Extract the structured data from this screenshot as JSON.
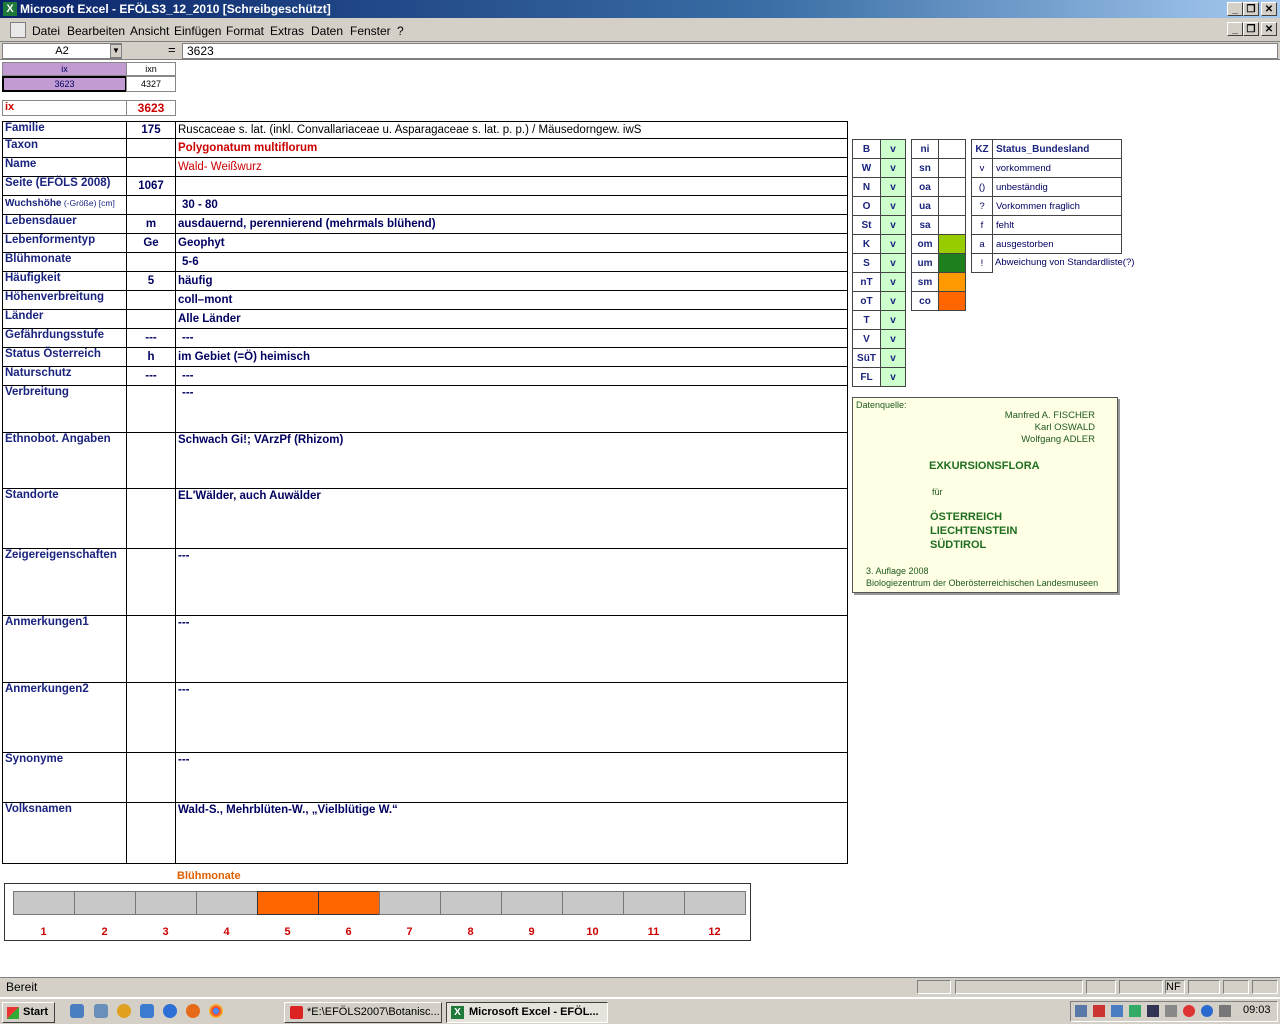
{
  "window": {
    "title": "Microsoft Excel - EFÖLS3_12_2010  [Schreibgeschützt]",
    "controls": [
      "_",
      "❐",
      "✕"
    ]
  },
  "menu": [
    "Datei",
    "Bearbeiten",
    "Ansicht",
    "Einfügen",
    "Format",
    "Extras",
    "Daten",
    "Fenster",
    "?"
  ],
  "formula": {
    "namebox": "A2",
    "eq": "=",
    "value": "3623"
  },
  "top": {
    "ix_header": "ix",
    "ixn_header": "ixn",
    "ix_value": "3623",
    "ixn_value": "4327",
    "ix_label": "ix",
    "ix_big": "3623"
  },
  "rows": [
    {
      "label": "Familie",
      "code": "175",
      "value": "Ruscaceae s. lat. (inkl. Convallariaceae u. Asparagaceae s. lat. p. p.)  /  Mäusedorngew. iwS"
    },
    {
      "label": "Taxon",
      "code": "",
      "value": "Polygonatum multiflorum"
    },
    {
      "label": "Name",
      "code": "",
      "value": "Wald- Weißwurz"
    },
    {
      "label": "Seite (EFÖLS 2008)",
      "code": "1067",
      "value": ""
    },
    {
      "label": "Wuchshöhe",
      "label_small": " (-Größe) [cm]",
      "code": "",
      "value": "30 - 80"
    },
    {
      "label": "Lebensdauer",
      "code": "m",
      "value": "ausdauernd, perennierend (mehrmals blühend)"
    },
    {
      "label": "Lebenformentyp",
      "code": "Ge",
      "value": "Geophyt"
    },
    {
      "label": "Blühmonate",
      "code": "",
      "value": "5-6"
    },
    {
      "label": "Häufigkeit",
      "code": "5",
      "value": "häufig"
    },
    {
      "label": "Höhenverbreitung",
      "code": "",
      "value": "coll–mont"
    },
    {
      "label": "Länder",
      "code": "",
      "value": "Alle Länder"
    },
    {
      "label": "Gefährdungsstufe",
      "code": "---",
      "value": "---"
    },
    {
      "label": "Status Österreich",
      "code": "h",
      "value": "im Gebiet (=Ö) heimisch"
    },
    {
      "label": "Naturschutz",
      "code": "---",
      "value": "---"
    },
    {
      "label": "Verbreitung",
      "code": "",
      "value": "---"
    },
    {
      "label": "Ethnobot. Angaben",
      "code": "",
      "value": "Schwach Gi!; VArzPf (Rhizom)"
    },
    {
      "label": "Standorte",
      "code": "",
      "value": "EL'Wälder, auch Auwälder"
    },
    {
      "label": "Zeigereigenschaften",
      "code": "",
      "value": "---"
    },
    {
      "label": "Anmerkungen1",
      "code": "",
      "value": "---"
    },
    {
      "label": "Anmerkungen2",
      "code": "",
      "value": "---"
    },
    {
      "label": "Synonyme",
      "code": "",
      "value": "---"
    },
    {
      "label": "Volksnamen",
      "code": "",
      "value": "Wald-S., Mehrblüten-W., „Vielblütige W.“"
    }
  ],
  "states": [
    {
      "code": "B",
      "v": "v"
    },
    {
      "code": "W",
      "v": "v"
    },
    {
      "code": "N",
      "v": "v"
    },
    {
      "code": "O",
      "v": "v"
    },
    {
      "code": "St",
      "v": "v"
    },
    {
      "code": "K",
      "v": "v"
    },
    {
      "code": "S",
      "v": "v"
    },
    {
      "code": "nT",
      "v": "v"
    },
    {
      "code": "oT",
      "v": "v"
    },
    {
      "code": "T",
      "v": "v"
    },
    {
      "code": "V",
      "v": "v"
    },
    {
      "code": "SüT",
      "v": "v"
    },
    {
      "code": "FL",
      "v": "v"
    }
  ],
  "zones": [
    {
      "code": "ni",
      "color": ""
    },
    {
      "code": "sn",
      "color": ""
    },
    {
      "code": "oa",
      "color": ""
    },
    {
      "code": "ua",
      "color": ""
    },
    {
      "code": "sa",
      "color": ""
    },
    {
      "code": "om",
      "color": "#99cc00"
    },
    {
      "code": "um",
      "color": "#1e7f1e"
    },
    {
      "code": "sm",
      "color": "#ff9900"
    },
    {
      "code": "co",
      "color": "#ff6600"
    }
  ],
  "status_legend": {
    "header_kz": "KZ",
    "header_status": "Status_Bundesland",
    "items": [
      {
        "kz": "v",
        "text": "vorkommend"
      },
      {
        "kz": "()",
        "text": "unbeständig"
      },
      {
        "kz": "?",
        "text": "Vorkommen fraglich"
      },
      {
        "kz": "f",
        "text": "fehlt"
      },
      {
        "kz": "a",
        "text": "ausgestorben"
      },
      {
        "kz": "!",
        "text": "Abweichung von Standardliste(?)"
      }
    ]
  },
  "source": {
    "label": "Datenquelle:",
    "authors": [
      "Manfred A. FISCHER",
      "Karl OSWALD",
      "Wolfgang ADLER"
    ],
    "title": "EXKURSIONSFLORA",
    "fuer": "für",
    "countries": [
      "ÖSTERREICH",
      "LIECHTENSTEIN",
      "SÜDTIROL"
    ],
    "edition": "3. Auflage 2008",
    "publisher": "Biologiezentrum der Oberösterreichischen Landesmuseen"
  },
  "bloom_chart": {
    "title": "Blühmonate",
    "months": [
      "1",
      "2",
      "3",
      "4",
      "5",
      "6",
      "7",
      "8",
      "9",
      "10",
      "11",
      "12"
    ],
    "flowering": [
      5,
      6
    ],
    "color_on": "#ff6600",
    "color_off": "#c8c8c8"
  },
  "statusbar": {
    "text": "Bereit",
    "nf": "NF"
  },
  "taskbar": {
    "start": "Start",
    "tasks": [
      "*E:\\EFÖLS2007\\Botanisc...",
      "Microsoft Excel - EFÖL..."
    ],
    "clock": "09:03"
  },
  "colors": {
    "accent_purple": "#c39bd3",
    "green_cell": "#ccffcc",
    "source_bg": "#ffffe6",
    "label_blue": "#1a237e"
  }
}
